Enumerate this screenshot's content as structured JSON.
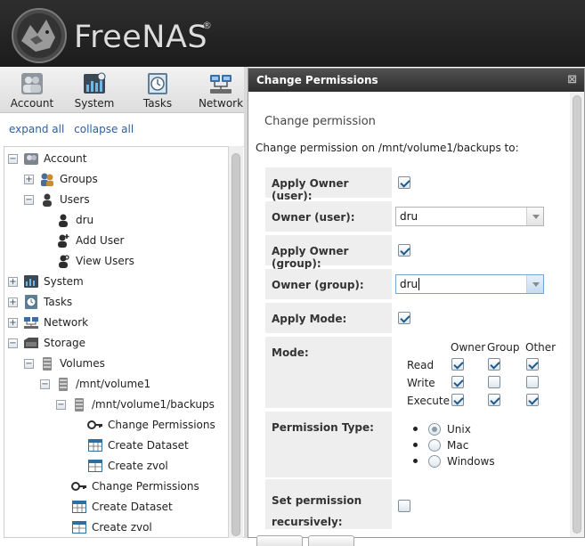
{
  "app": {
    "logo_text": "FreeNAS",
    "logo_mark": "®",
    "logo_icon": "freenas-shark-icon"
  },
  "nav": {
    "buttons": [
      {
        "label": "Account",
        "icon": "account-icon"
      },
      {
        "label": "System",
        "icon": "system-icon"
      },
      {
        "label": "Tasks",
        "icon": "tasks-icon"
      },
      {
        "label": "Network",
        "icon": "network-icon"
      }
    ],
    "expand_all": "expand all",
    "collapse_all": "collapse all"
  },
  "tree": {
    "nodes": [
      {
        "label": "Account",
        "toggle": "−",
        "icon": "account-icon"
      },
      {
        "label": "Groups",
        "toggle": "+",
        "icon": "groups-icon"
      },
      {
        "label": "Users",
        "toggle": "−",
        "icon": "users-icon"
      },
      {
        "label": "dru",
        "icon": "user-icon"
      },
      {
        "label": "Add User",
        "icon": "add-user-icon"
      },
      {
        "label": "View Users",
        "icon": "view-users-icon"
      },
      {
        "label": "System",
        "toggle": "+",
        "icon": "system-icon"
      },
      {
        "label": "Tasks",
        "toggle": "+",
        "icon": "tasks-icon"
      },
      {
        "label": "Network",
        "toggle": "+",
        "icon": "network-icon"
      },
      {
        "label": "Storage",
        "toggle": "−",
        "icon": "storage-icon"
      },
      {
        "label": "Volumes",
        "toggle": "−",
        "icon": "volume-icon"
      },
      {
        "label": "/mnt/volume1",
        "toggle": "−",
        "icon": "volume-icon"
      },
      {
        "label": "/mnt/volume1/backups",
        "toggle": "−",
        "icon": "volume-icon"
      },
      {
        "label": "Change Permissions",
        "icon": "key-icon"
      },
      {
        "label": "Create Dataset",
        "icon": "dataset-icon"
      },
      {
        "label": "Create zvol",
        "icon": "zvol-icon"
      },
      {
        "label": "Change Permissions",
        "icon": "key-icon"
      },
      {
        "label": "Create Dataset",
        "icon": "dataset-icon"
      },
      {
        "label": "Create zvol",
        "icon": "zvol-icon"
      }
    ]
  },
  "dialog": {
    "title": "Change Permissions",
    "close_glyph": "⊠",
    "subtitle": "Change permission",
    "path_text": "Change permission on /mnt/volume1/backups to:",
    "apply_owner_user": {
      "label": "Apply Owner (user):",
      "checked": true
    },
    "owner_user": {
      "label": "Owner (user):",
      "value": "dru"
    },
    "apply_owner_group": {
      "label": "Apply Owner (group):",
      "checked": true
    },
    "owner_group": {
      "label": "Owner (group):",
      "value": "dru"
    },
    "apply_mode": {
      "label": "Apply Mode:",
      "checked": true
    },
    "mode": {
      "label": "Mode:",
      "columns": [
        "Owner",
        "Group",
        "Other"
      ],
      "rows": [
        {
          "label": "Read",
          "values": [
            true,
            true,
            true
          ]
        },
        {
          "label": "Write",
          "values": [
            true,
            false,
            false
          ]
        },
        {
          "label": "Execute",
          "values": [
            true,
            true,
            true
          ]
        }
      ]
    },
    "permission_type": {
      "label": "Permission Type:",
      "options": [
        "Unix",
        "Mac",
        "Windows"
      ],
      "selected": "Unix"
    },
    "recursive": {
      "label_line1": "Set permission",
      "label_line2": "recursively:",
      "checked": false
    }
  }
}
